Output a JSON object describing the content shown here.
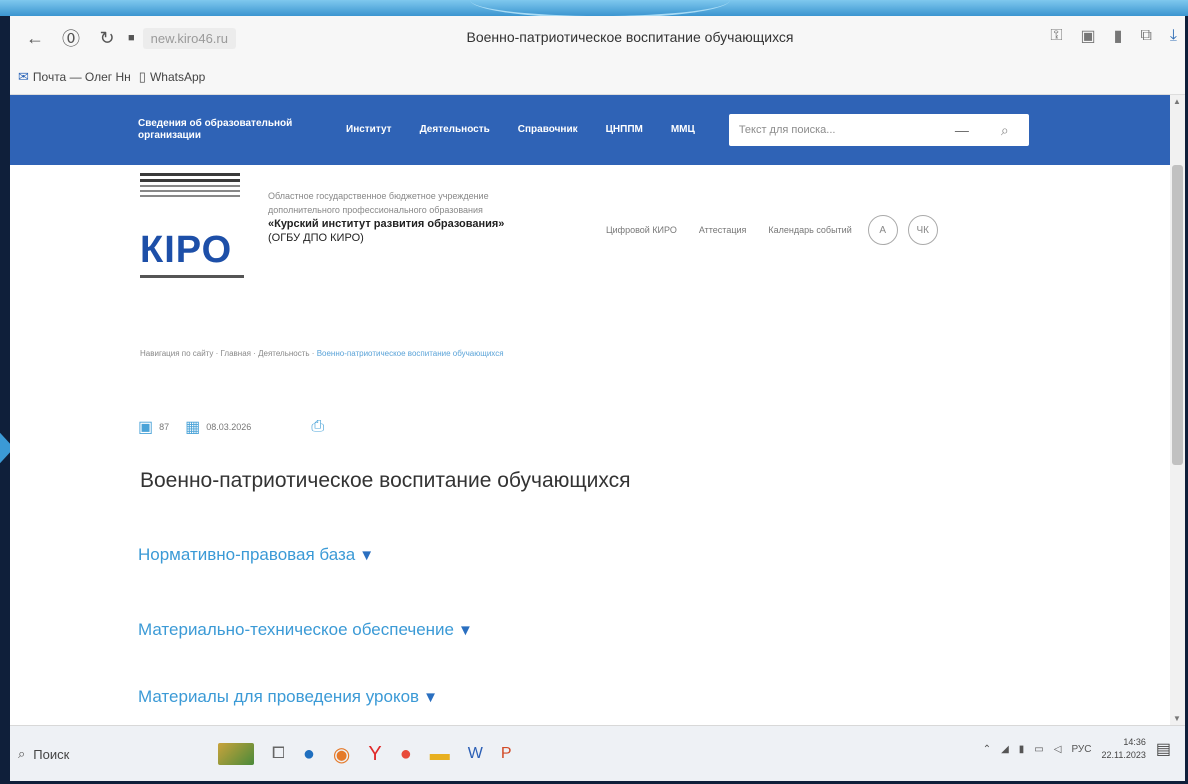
{
  "browser": {
    "url": "new.kiro46.ru",
    "tab_title": "Военно-патриотическое воспитание обучающихся",
    "bookmarks": [
      {
        "label": "Почта — Олег Нн",
        "icon": "mail-icon"
      },
      {
        "label": "WhatsApp",
        "icon": "document-icon"
      }
    ]
  },
  "site": {
    "nav": [
      "Сведения об образовательной организации",
      "Институт",
      "Деятельность",
      "Справочник",
      "ЦНППМ",
      "ММЦ"
    ],
    "search_placeholder": "Текст для поиска..."
  },
  "header": {
    "org_line1": "Областное государственное бюджетное учреждение",
    "org_line2": "дополнительного профессионального образования",
    "org_name": "«Курский институт развития образования»",
    "org_abbr": "(ОГБУ ДПО КИРО)",
    "logo_text": "КІРО",
    "links": [
      "Цифровой КИРО",
      "Аттестация",
      "Календарь событий"
    ],
    "buttons": [
      "A",
      "ЧК"
    ]
  },
  "breadcrumb": {
    "path": "Навигация по сайту · Главная · Деятельность · ",
    "current": "Военно-патриотическое воспитание обучающихся"
  },
  "meta": {
    "views": "87",
    "date": "08.03.2026"
  },
  "page": {
    "title": "Военно-патриотическое воспитание обучающихся",
    "sections": [
      "Нормативно-правовая база",
      "Материально-техническое обеспечение",
      "Материалы для проведения уроков"
    ],
    "arrow": "▼"
  },
  "taskbar": {
    "search": "Поиск",
    "lang": "РУС",
    "time": "14:36",
    "date": "22.11.2023"
  }
}
